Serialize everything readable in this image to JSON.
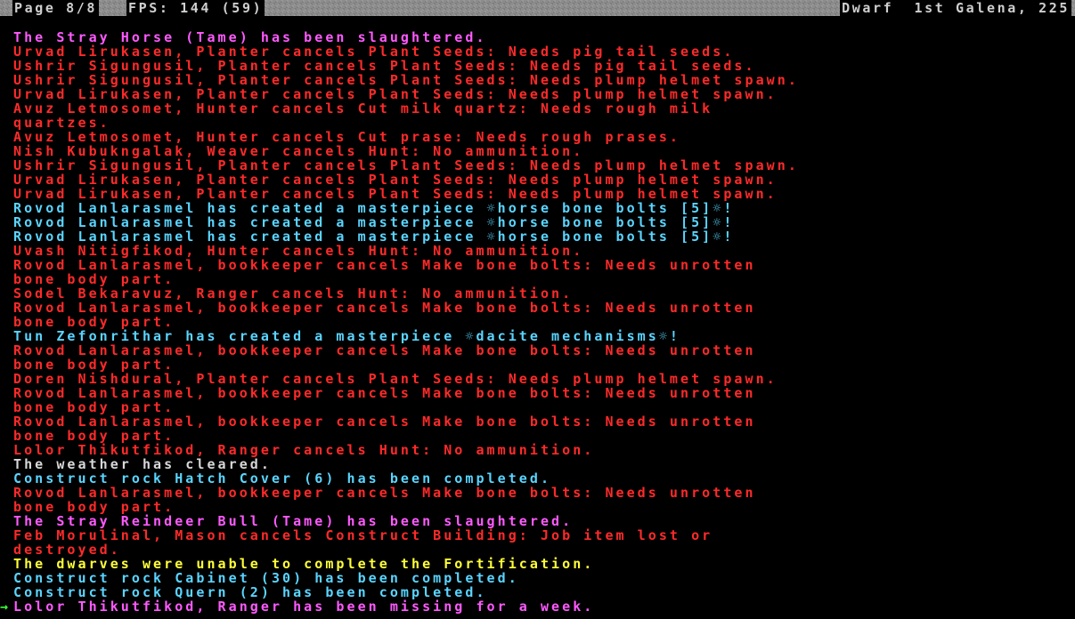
{
  "status_bar": {
    "page": "Page 8/8",
    "fps": "FPS: 144 (59)",
    "mode": "Dwarf  1st Galena, 225"
  },
  "cursor_glyph": "→",
  "colors": {
    "pink": "#ff5aff",
    "red": "#ff2a2a",
    "cyan": "#5ad5ff",
    "white": "#d8d8d8",
    "yellow": "#ffff3a",
    "cursor": "#3aff3a"
  },
  "messages": [
    "The Stray Horse (Tame) has been slaughtered.",
    "Urvad Lirukasen, Planter cancels Plant Seeds: Needs pig tail seeds.",
    "Ushrir Sigungusil, Planter cancels Plant Seeds: Needs pig tail seeds.",
    "Ushrir Sigungusil, Planter cancels Plant Seeds: Needs plump helmet spawn.",
    "Urvad Lirukasen, Planter cancels Plant Seeds: Needs plump helmet spawn.",
    "Avuz Letmosomet, Hunter cancels Cut milk quartz: Needs rough milk",
    "quartzes.",
    "Avuz Letmosomet, Hunter cancels Cut prase: Needs rough prases.",
    "Nish Kubukngalak, Weaver cancels Hunt: No ammunition.",
    "Ushrir Sigungusil, Planter cancels Plant Seeds: Needs plump helmet spawn.",
    "Urvad Lirukasen, Planter cancels Plant Seeds: Needs plump helmet spawn.",
    "Urvad Lirukasen, Planter cancels Plant Seeds: Needs plump helmet spawn.",
    "Rovod Lanlarasmel has created a masterpiece ☼horse bone bolts [5]☼!",
    "Rovod Lanlarasmel has created a masterpiece ☼horse bone bolts [5]☼!",
    "Rovod Lanlarasmel has created a masterpiece ☼horse bone bolts [5]☼!",
    "Uvash Nitigfikod, Hunter cancels Hunt: No ammunition.",
    "Rovod Lanlarasmel, bookkeeper cancels Make bone bolts: Needs unrotten",
    "bone body part.",
    "Sodel Bekaravuz, Ranger cancels Hunt: No ammunition.",
    "Rovod Lanlarasmel, bookkeeper cancels Make bone bolts: Needs unrotten",
    "bone body part.",
    "Tun Zefonrithar has created a masterpiece ☼dacite mechanisms☼!",
    "Rovod Lanlarasmel, bookkeeper cancels Make bone bolts: Needs unrotten",
    "bone body part.",
    "Doren Nishdural, Planter cancels Plant Seeds: Needs plump helmet spawn.",
    "Rovod Lanlarasmel, bookkeeper cancels Make bone bolts: Needs unrotten",
    "bone body part.",
    "Rovod Lanlarasmel, bookkeeper cancels Make bone bolts: Needs unrotten",
    "bone body part.",
    "Lolor Thikutfikod, Ranger cancels Hunt: No ammunition.",
    "The weather has cleared.",
    "Construct rock Hatch Cover (6) has been completed.",
    "Rovod Lanlarasmel, bookkeeper cancels Make bone bolts: Needs unrotten",
    "bone body part.",
    "The Stray Reindeer Bull (Tame) has been slaughtered.",
    "Feb Morulinal, Mason cancels Construct Building: Job item lost or",
    "destroyed.",
    "The dwarves were unable to complete the Fortification.",
    "Construct rock Cabinet (30) has been completed.",
    "Construct rock Quern (2) has been completed.",
    "Lolor Thikutfikod, Ranger has been missing for a week."
  ]
}
